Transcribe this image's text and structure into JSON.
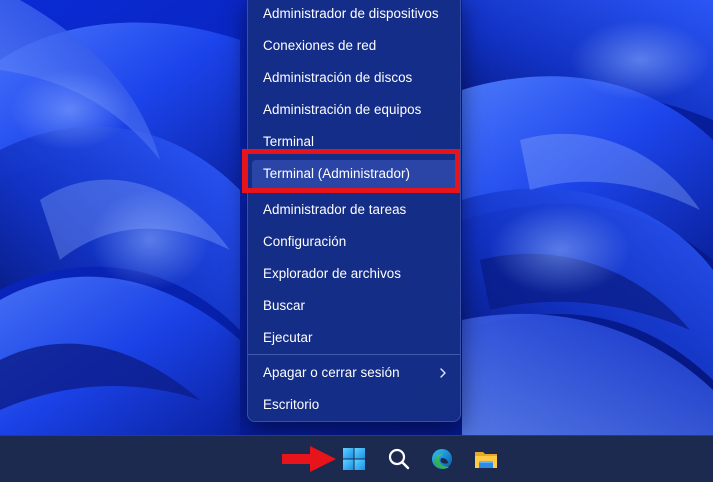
{
  "colors": {
    "menu_bg": "#162e84",
    "highlight_box": "#e8141b",
    "arrow": "#e8141b",
    "taskbar_bg": "#1c2a4f",
    "wallpaper_blue": "#1a3fe0"
  },
  "context_menu": {
    "items": [
      {
        "label": "Administrador de dispositivos",
        "icon": ""
      },
      {
        "label": "Conexiones de red",
        "icon": ""
      },
      {
        "label": "Administración de discos",
        "icon": ""
      },
      {
        "label": "Administración de equipos",
        "icon": ""
      },
      {
        "label": "Terminal",
        "icon": ""
      },
      {
        "label": "Terminal (Administrador)",
        "icon": "",
        "highlighted": true
      },
      {
        "label": "Administrador de tareas",
        "icon": ""
      },
      {
        "label": "Configuración",
        "icon": ""
      },
      {
        "label": "Explorador de archivos",
        "icon": ""
      },
      {
        "label": "Buscar",
        "icon": ""
      },
      {
        "label": "Ejecutar",
        "icon": ""
      },
      {
        "label": "Apagar o cerrar sesión",
        "icon": "chevron-right-icon",
        "has_submenu": true
      },
      {
        "label": "Escritorio",
        "icon": ""
      }
    ]
  },
  "taskbar": {
    "buttons": [
      {
        "icon": "windows-start-icon"
      },
      {
        "icon": "search-icon"
      },
      {
        "icon": "edge-browser-icon"
      },
      {
        "icon": "file-explorer-icon"
      }
    ]
  },
  "annotations": {
    "arrow_icon": "red-arrow-icon",
    "highlight": "red-highlight-box"
  }
}
